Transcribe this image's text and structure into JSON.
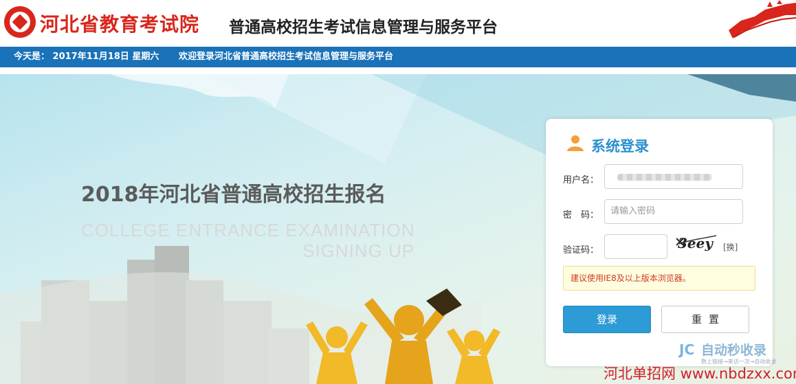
{
  "header": {
    "brand": "河北省教育考试院",
    "subtitle": "普通高校招生考试信息管理与服务平台"
  },
  "infobar": {
    "date": "今天是： 2017年11月18日 星期六",
    "welcome": "欢迎登录河北省普通高校招生考试信息管理与服务平台"
  },
  "banner": {
    "title": "2018年河北省普通高校招生报名",
    "english_line1": "COLLEGE ENTRANCE EXAMINATION",
    "english_line2": "SIGNING UP"
  },
  "login": {
    "title": "系统登录",
    "username_label": "用户名：",
    "password_label": "密　码：",
    "password_placeholder": "请输入密码",
    "captcha_label": "验证码：",
    "captcha_value": "3eey",
    "captcha_refresh": "[换]",
    "tip": "建议使用IE8及以上版本浏览器。",
    "login_button": "登录",
    "reset_button": "重置"
  },
  "stamp": {
    "logo_text": "JC",
    "text": "自动秒收录",
    "sub": "数上链接→来访一次→自动收录"
  },
  "watermark": "河北单招网 www.nbdzxx.com",
  "colors": {
    "brand_red": "#d9261c",
    "nav_blue": "#1a72b8",
    "accent_blue": "#2d9bd6",
    "people_yellow": "#f2b928"
  },
  "icons": [
    "logo-icon",
    "great-wall-icon",
    "user-icon",
    "captcha-image"
  ]
}
